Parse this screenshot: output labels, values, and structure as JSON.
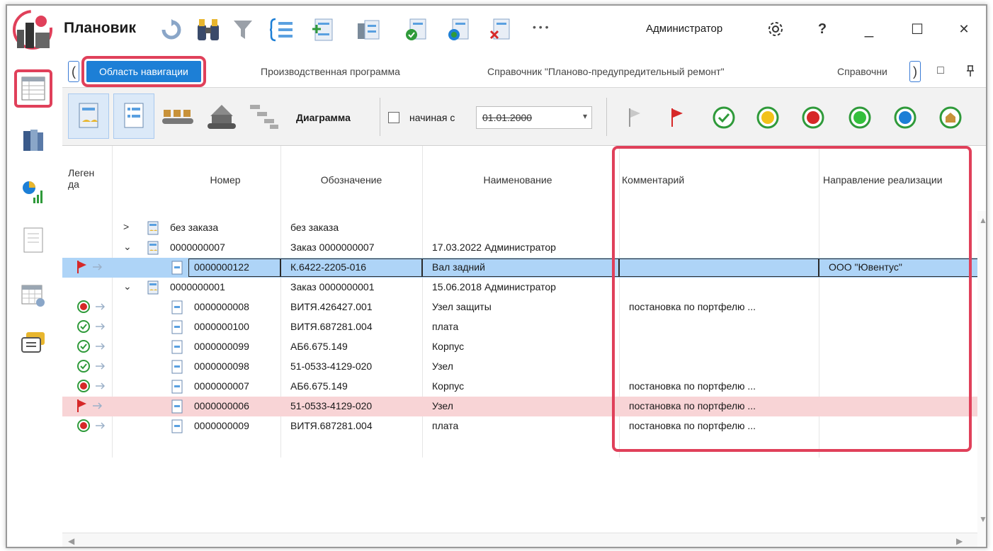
{
  "app": {
    "title": "Плановик",
    "user": "Администратор",
    "more": "• • •",
    "help": "?",
    "minimize": "_",
    "maximize": "☐",
    "close": "✕"
  },
  "toolbar_top_icons": [
    "refresh-icon",
    "binoculars-icon",
    "filter-icon",
    "tree-list-icon",
    "add-list-icon",
    "plan-icon",
    "approve-doc-icon",
    "circle-doc-icon",
    "reject-doc-icon"
  ],
  "nav_rail": [
    "table-icon",
    "books-icon",
    "chart-icon",
    "document-icon",
    "calendar-gear-icon",
    "chat-icon"
  ],
  "tabs": {
    "left_arrow": "(",
    "right_arrow": ")",
    "items": [
      {
        "label": "Область навигации",
        "active": true
      },
      {
        "label": "Производственная программа",
        "active": false
      },
      {
        "label": "Справочник \"Планово-предупредительный ремонт\"",
        "active": false
      },
      {
        "label": "Справочни",
        "active": false
      }
    ],
    "restore": "□",
    "pin": "ꟷ"
  },
  "toolbar": {
    "diagram_label": "Диаграмма",
    "start_label": "начиная с",
    "start_date": "01.01.2000",
    "date_dropdown": "▾"
  },
  "grid": {
    "headers": {
      "legend": "Леген да",
      "number": "Номер",
      "designation": "Обозначение",
      "name": "Наименование",
      "comment": "Комментарий",
      "direction": "Направление реализации"
    },
    "rows": [
      {
        "legend": "",
        "expander": ">",
        "indent": 1,
        "number": "без заказа",
        "designation": "без заказа",
        "name": "",
        "comment": "",
        "direction": "",
        "style": "normal"
      },
      {
        "legend": "",
        "expander": "⌄",
        "indent": 1,
        "number": "0000000007",
        "designation": "Заказ 0000000007",
        "name": "17.03.2022 Администратор",
        "comment": "",
        "direction": "",
        "style": "normal"
      },
      {
        "legend": "red-flag",
        "expander": "",
        "indent": 2,
        "number": "0000000122",
        "designation": "К.6422-2205-016",
        "name": "Вал задний",
        "comment": "",
        "direction": "ООО \"Ювентус\"",
        "style": "sel"
      },
      {
        "legend": "",
        "expander": "⌄",
        "indent": 1,
        "number": "0000000001",
        "designation": "Заказ 0000000001",
        "name": "15.06.2018 Администратор",
        "comment": "",
        "direction": "",
        "style": "normal"
      },
      {
        "legend": "red-circle",
        "expander": "",
        "indent": 2,
        "number": "0000000008",
        "designation": "ВИТЯ.426427.001",
        "name": "Узел защиты",
        "comment": "постановка по портфелю ...",
        "direction": "",
        "style": "normal"
      },
      {
        "legend": "green-check",
        "expander": "",
        "indent": 2,
        "number": "0000000100",
        "designation": "ВИТЯ.687281.004",
        "name": "плата",
        "comment": "",
        "direction": "",
        "style": "normal"
      },
      {
        "legend": "green-check",
        "expander": "",
        "indent": 2,
        "number": "0000000099",
        "designation": "АБ6.675.149",
        "name": "Корпус",
        "comment": "",
        "direction": "",
        "style": "normal"
      },
      {
        "legend": "green-check",
        "expander": "",
        "indent": 2,
        "number": "0000000098",
        "designation": "51-0533-4129-020",
        "name": "Узел",
        "comment": "",
        "direction": "",
        "style": "normal"
      },
      {
        "legend": "red-circle",
        "expander": "",
        "indent": 2,
        "number": "0000000007",
        "designation": "АБ6.675.149",
        "name": "Корпус",
        "comment": "постановка по портфелю ...",
        "direction": "",
        "style": "normal"
      },
      {
        "legend": "red-flag",
        "expander": "",
        "indent": 2,
        "number": "0000000006",
        "designation": "51-0533-4129-020",
        "name": "Узел",
        "comment": "постановка по портфелю ...",
        "direction": "",
        "style": "pink"
      },
      {
        "legend": "red-circle",
        "expander": "",
        "indent": 2,
        "number": "0000000009",
        "designation": "ВИТЯ.687281.004",
        "name": "плата",
        "comment": "постановка по портфелю ...",
        "direction": "",
        "style": "normal"
      }
    ]
  },
  "colors": {
    "accent": "#1d7fd6",
    "highlight": "#e0405a",
    "selected_row": "#aed4f7",
    "pink_row": "#f8d4d6"
  }
}
